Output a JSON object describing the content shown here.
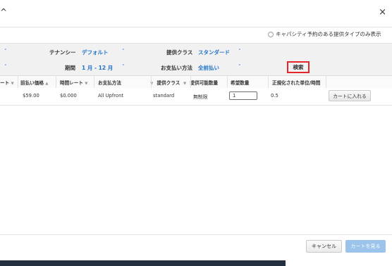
{
  "header": {
    "title": "^",
    "close_icon": "×"
  },
  "capacity_filter": {
    "label": "キャパシティ予約のある提供タイプのみ表示"
  },
  "filters": {
    "tenancy_label": "テナンシー",
    "tenancy_value": "デフォルト",
    "offering_class_label": "提供クラス",
    "offering_class_value": "スタンダード",
    "term_label": "期間",
    "term_value": "1 月 - 12 月",
    "payment_label": "お支払い方法",
    "payment_value": "全前払い",
    "search_label": "検索",
    "chevron": "˅"
  },
  "table": {
    "columns": [
      "ート",
      "前払い価格",
      "時間レート",
      "お支払方法",
      "提供クラス",
      "提供可能数量",
      "希望数量",
      "正規化された単位/時間"
    ],
    "sort_asc": "▲",
    "sort_desc": "▼",
    "row": {
      "upfront": "$59.00",
      "hourly": "$0.000",
      "payment": "All Upfront",
      "offering_class": "standard",
      "available": "無制限",
      "desired": "1",
      "normalized": "0.5",
      "add_to_cart": "カートに入れる"
    }
  },
  "footer": {
    "cancel": "キャンセル",
    "view_cart": "カートを見る"
  },
  "colors": {
    "accent_blue": "#1f73c7",
    "highlight_red": "#e4262a",
    "disabled_button": "#9cc4ea"
  }
}
